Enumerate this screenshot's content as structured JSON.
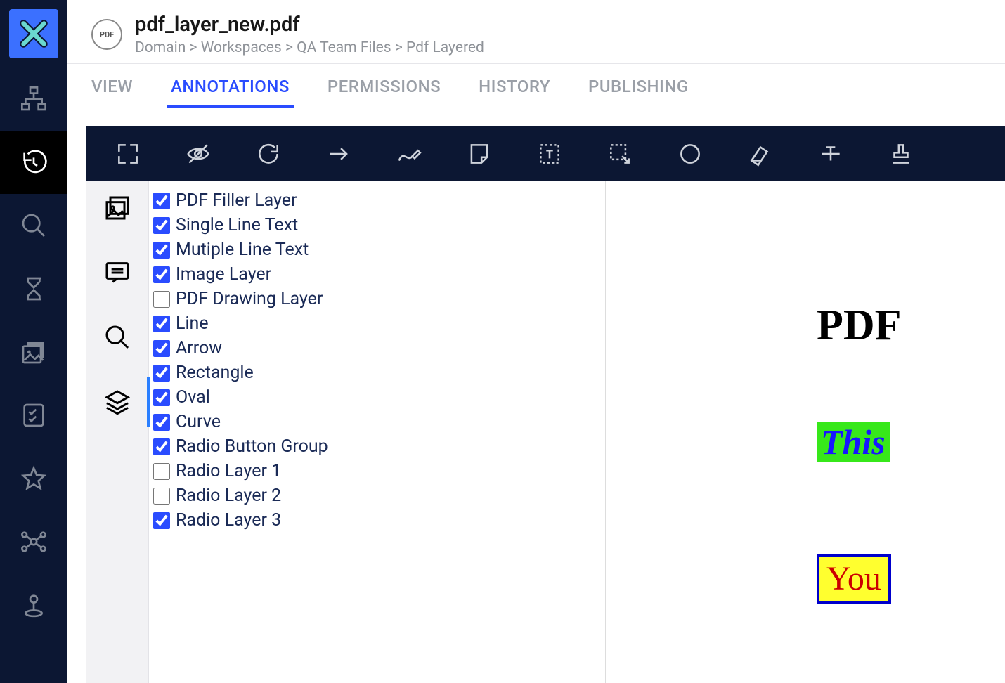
{
  "header": {
    "file_title": "pdf_layer_new.pdf",
    "badge_label": "PDF",
    "breadcrumb": "Domain > Workspaces > QA Team Files > Pdf Layered"
  },
  "tabs": {
    "view": "VIEW",
    "annotations": "ANNOTATIONS",
    "permissions": "PERMISSIONS",
    "history": "HISTORY",
    "publishing": "PUBLISHING"
  },
  "layers": [
    {
      "label": "PDF Filler Layer",
      "checked": true
    },
    {
      "label": "Single Line Text",
      "checked": true
    },
    {
      "label": "Mutiple Line Text",
      "checked": true
    },
    {
      "label": "Image Layer",
      "checked": true
    },
    {
      "label": "PDF Drawing Layer",
      "checked": false
    },
    {
      "label": "Line",
      "checked": true
    },
    {
      "label": "Arrow",
      "checked": true
    },
    {
      "label": "Rectangle",
      "checked": true
    },
    {
      "label": "Oval",
      "checked": true
    },
    {
      "label": "Curve",
      "checked": true
    },
    {
      "label": "Radio Button Group",
      "checked": true
    },
    {
      "label": "Radio Layer 1",
      "checked": false
    },
    {
      "label": "Radio Layer 2",
      "checked": false
    },
    {
      "label": "Radio Layer 3",
      "checked": true
    }
  ],
  "preview": {
    "heading": "PDF",
    "highlight": "This ",
    "box_text": "You "
  }
}
